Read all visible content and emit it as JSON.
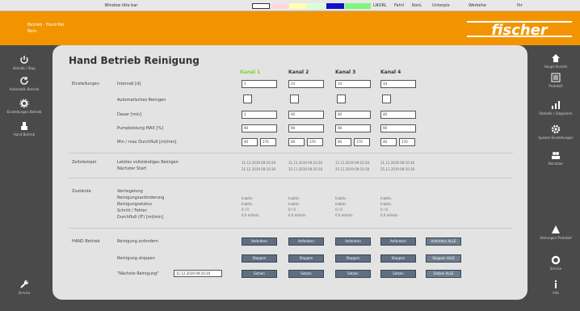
{
  "window": {
    "title": "Window title bar"
  },
  "topbar_right": [
    "LNORL",
    "Fahrl",
    "KonL",
    "Unterple",
    "Werkehe",
    "Ihr"
  ],
  "header": {
    "line1": "Betrieb  ·  Hand  Rei",
    "line2": "Rein.",
    "logo_text": "fischer"
  },
  "left_sidebar": [
    {
      "icon": "power-icon",
      "label": "Betrieb / Stop"
    },
    {
      "icon": "refresh-icon",
      "label": "Automatik Betrieb"
    },
    {
      "icon": "settings-icon",
      "label": "Einstellungen Betrieb"
    },
    {
      "icon": "hand-icon",
      "label": "Hand Betrieb"
    },
    {
      "icon": "wrench-icon",
      "label": "Service"
    }
  ],
  "right_sidebar": [
    {
      "icon": "home-icon",
      "label": "Haupt Ansicht"
    },
    {
      "icon": "list-icon",
      "label": "Protokoll"
    },
    {
      "icon": "chart-icon",
      "label": "Statistik / Diagramm"
    },
    {
      "icon": "gear-icon",
      "label": "System Einstellungen"
    },
    {
      "icon": "users-icon",
      "label": "Benutzer"
    },
    {
      "icon": "alarm-icon",
      "label": "Störungen Protokoll"
    },
    {
      "icon": "config-icon",
      "label": "Service"
    },
    {
      "icon": "info-icon",
      "label": "Info"
    }
  ],
  "main": {
    "title": "Hand Betrieb Reinigung",
    "kanal_headers": [
      "Kanal 1",
      "Kanal 2",
      "Kanal 3",
      "Kanal 4"
    ],
    "einstellungen": {
      "section": "Einstellungen",
      "rows": [
        "Intervall [d]",
        "Automatisches Reinigen",
        "Dauer [min]",
        "Pumpleistung  MAX [%]",
        "Min / max Durchfluß [ml/min]"
      ],
      "intervall": [
        "1",
        "14",
        "14",
        "14"
      ],
      "dauer": [
        "1",
        "40",
        "40",
        "40"
      ],
      "pumpleistung": [
        "90",
        "90",
        "90",
        "90"
      ],
      "durchfluss_min": [
        "40",
        "40",
        "40",
        "40"
      ],
      "durchfluss_max": [
        "170",
        "170",
        "170",
        "170"
      ]
    },
    "zeitstempel": {
      "section": "Zeitstempel",
      "rows": [
        "Letztes vollständiges Reinigen",
        "Nächster Start"
      ],
      "letztes": [
        "11.12.2019 09:10:30",
        "11.11.2019 09:10:30",
        "11.11.2019 09:10:30",
        "11.11.2019 09:10:30"
      ],
      "naechster": [
        "11.12.2019 09:10:30",
        "25.11.2019 09:10:30",
        "25.11.2019 09:10:30",
        "25.11.2019 09:10:30"
      ]
    },
    "zustaende": {
      "section": "Zustände",
      "rows": [
        "Verriegelung",
        "Reinigungsanforderung",
        "Reinigungsstatus",
        "Schritt / Fehler",
        "Durchfluß  (IF) [ml/min]"
      ],
      "kanal": [
        [
          "Inaktiv",
          "Inaktiv",
          "Inaktiv",
          "0 / 0",
          "0.0 ml/min"
        ],
        [
          "Inaktiv",
          "Inaktiv",
          "Inaktiv",
          "0 / 0",
          "0.0 ml/min"
        ],
        [
          "Inaktiv",
          "Inaktiv",
          "Inaktiv",
          "0 / 0",
          "0.0 ml/min"
        ],
        [
          "Inaktiv",
          "Inaktiv",
          "Inaktiv",
          "0 / 0",
          "0.0 ml/min"
        ]
      ]
    },
    "hand_betrieb": {
      "section": "HAND Betrieb",
      "rows": [
        "Reinigung anfordern",
        "Reinigung stoppen",
        "\"Nächste Reinigung\""
      ],
      "anfordern": [
        "Anfordern",
        "Anfordern",
        "Anfordern",
        "Anfordern",
        "Anfordern ALLE"
      ],
      "stoppen": [
        "Stoppen",
        "Stoppen",
        "Stoppen",
        "Stoppen",
        "Stoppen ALLE"
      ],
      "setzen": [
        "Setzen",
        "Setzen",
        "Setzen",
        "Setzen",
        "Setzen ALLE"
      ],
      "naechste_value": "11.12.2019 09:10:30"
    }
  },
  "colors": {
    "accent": "#f29400",
    "background": "#4a4a4a",
    "panel": "#e3e3e3",
    "button": "#5f6f82",
    "active_kanal": "#7bd23a"
  }
}
